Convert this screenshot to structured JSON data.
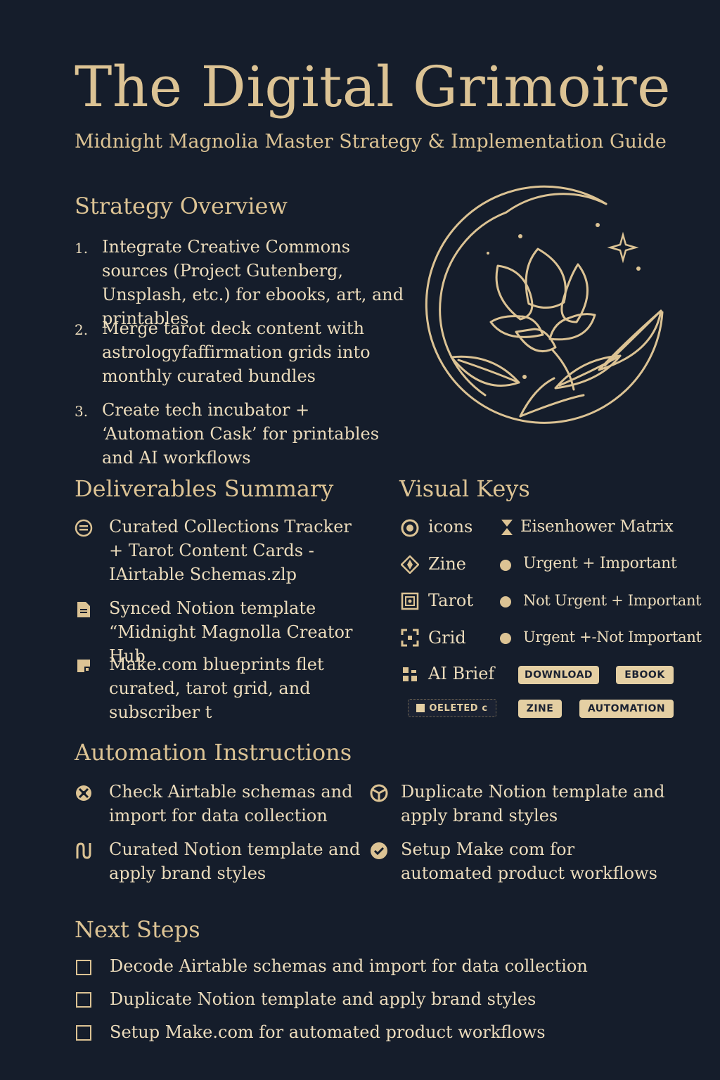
{
  "title": "The Digital Grimoire",
  "subtitle": "Midnight Magnolia Master Strategy & Implementation Guide",
  "colors": {
    "background": "#151d2b",
    "gold": "#dcc394",
    "text": "#ecdcbc",
    "badge": "#e4cfa3"
  },
  "strategy": {
    "heading": "Strategy Overview",
    "items": [
      {
        "number": "1.",
        "text": "Integrate Creative Commons sources (Project Gutenberg, Unsplash, etc.) for ebooks, art, and printables"
      },
      {
        "number": "2.",
        "text": "Merge tarot deck content with astrologyfaffirmation grids into monthly curated bundles"
      },
      {
        "number": "3.",
        "text": "Create tech incubator + ‘Automation Cask’ for printables and AI workflows"
      }
    ]
  },
  "deliverables": {
    "heading": "Deliverables Summary",
    "items": [
      {
        "icon": "list-badge-icon",
        "text": "Curated Collections Tracker + Tarot Content Cards - IAirtable Schemas.zlp"
      },
      {
        "icon": "document-icon",
        "text": "Synced Notion template “Midnight Magnolla Creator Hub"
      },
      {
        "icon": "blueprint-icon",
        "text": "Make.com blueprints flet curated, tarot grid, and subscriber t"
      }
    ]
  },
  "visual_keys": {
    "heading": "Visual Keys",
    "keys": [
      {
        "icon": "target-icon",
        "label": "icons"
      },
      {
        "icon": "compass-icon",
        "label": "Zine"
      },
      {
        "icon": "tarot-card-icon",
        "label": "Tarot"
      },
      {
        "icon": "grid-frame-icon",
        "label": "Grid"
      },
      {
        "icon": "ai-blocks-icon",
        "label": "AI Brief"
      }
    ],
    "matrix_title": "Eisenhower Matrix",
    "matrix_items": [
      "Urgent + Important",
      "Not Urgent + Important",
      "Urgent +-Not Important"
    ],
    "badges": [
      "DOWNLOAD",
      "EBOOK",
      "ZINE",
      "AUTOMATION"
    ],
    "deleted_badge": "OELETED c"
  },
  "automation": {
    "heading": "Automation Instructions",
    "items": [
      {
        "icon": "gear-cross-icon",
        "text": "Check Airtable schemas and import for data collection"
      },
      {
        "icon": "curve-n-icon",
        "text": "Curated Notion template and apply brand styles"
      },
      {
        "icon": "segmented-circle-icon",
        "text": "Duplicate Notion template and apply brand styles"
      },
      {
        "icon": "check-circle-icon",
        "text": "Setup Make com for automated product workflows"
      }
    ]
  },
  "next_steps": {
    "heading": "Next Steps",
    "items": [
      "Decode Airtable schemas and import for data collection",
      "Duplicate Notion template and apply brand styles",
      "Setup Make.com for automated product workflows"
    ]
  }
}
